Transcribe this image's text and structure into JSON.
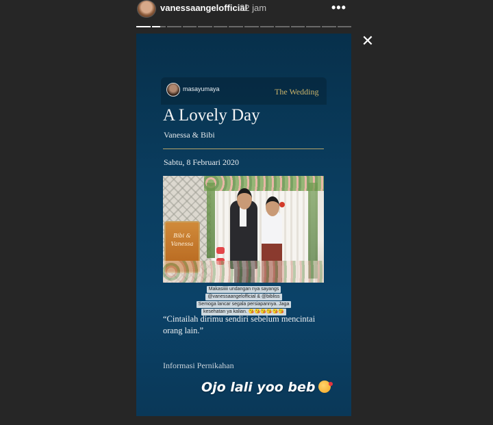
{
  "header": {
    "username": "vanessaangelofficial",
    "time": "22 jam",
    "more_icon": "•••",
    "progress": {
      "total_segments": 14,
      "current_segment": 1,
      "current_fill": 0.6
    }
  },
  "close_icon": "✕",
  "repost": {
    "username": "masayumaya",
    "tag": "The Wedding",
    "title": "A Lovely Day",
    "couple": "Vanessa & Bibi",
    "date": "Sabtu, 8 Februari 2020",
    "sign_text": "Bibi & Vanessa",
    "caption_lines": [
      "Makasiiiii undangan nya sayangs",
      "@vanessaangelofficial & @bibliss",
      "Semoga lancar segala persiapannya. Jaga",
      "kesehatan ya kalian. 😘😘😘😘😘😘"
    ],
    "quote": "“Cintailah dirimu sendiri sebelum mencintai orang lain.”",
    "info": "Informasi Pernikahan"
  },
  "overlay": {
    "text": "Ojo lali yoo beb"
  },
  "colors": {
    "background": "#262626",
    "story_bg": "#0a3d5f",
    "accent_gold": "#c9b36a"
  }
}
